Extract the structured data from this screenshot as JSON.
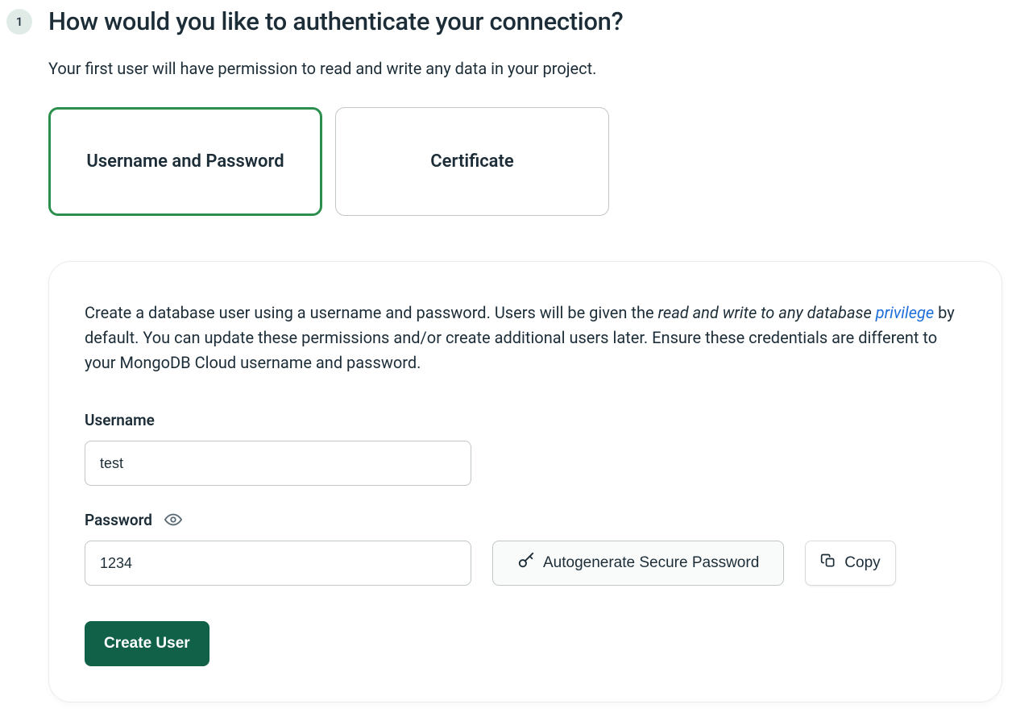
{
  "step": {
    "number": "1",
    "title": "How would you like to authenticate your connection?",
    "subtitle": "Your first user will have permission to read and write any data in your project."
  },
  "authOptions": {
    "usernamePassword": "Username and Password",
    "certificate": "Certificate"
  },
  "card": {
    "description": {
      "prefix": "Create a database user using a username and password. Users will be given the ",
      "italic_part": "read and write to any database ",
      "link_text": "privilege",
      "suffix": " by default. You can update these permissions and/or create additional users later. Ensure these credentials are different to your MongoDB Cloud username and password."
    },
    "username": {
      "label": "Username",
      "value": "test"
    },
    "password": {
      "label": "Password",
      "value": "1234"
    },
    "buttons": {
      "autogenerate": "Autogenerate Secure Password",
      "copy": "Copy",
      "createUser": "Create User"
    }
  }
}
